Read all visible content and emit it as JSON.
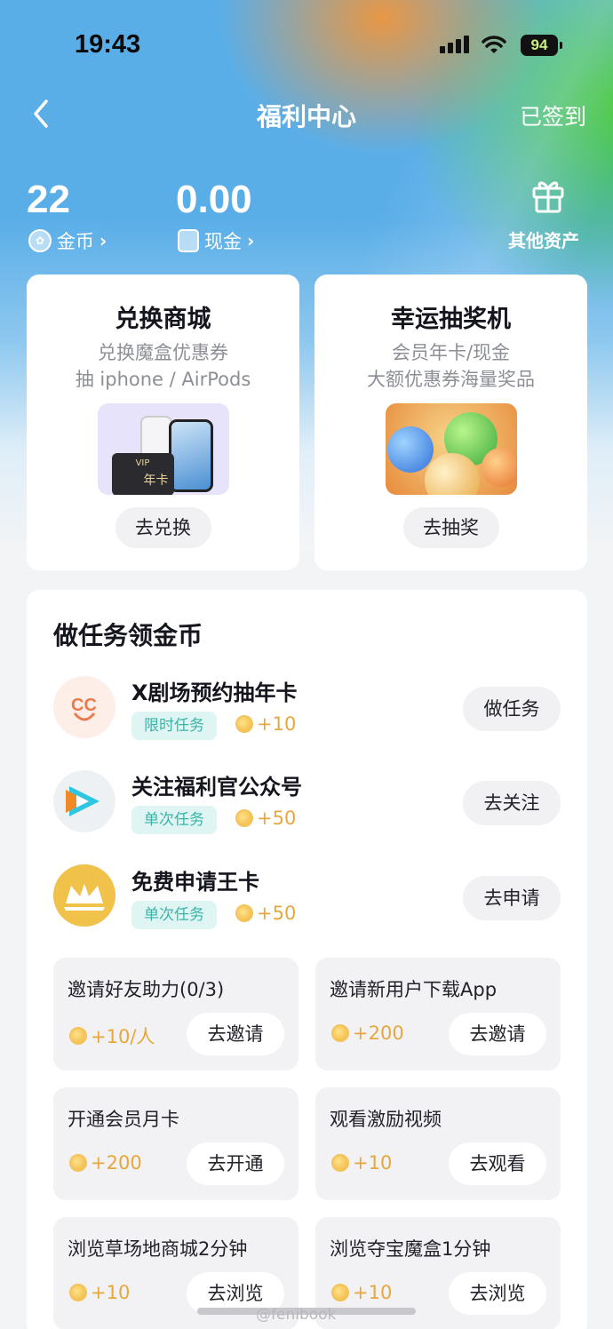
{
  "status_bar": {
    "time": "19:43",
    "battery": "94"
  },
  "nav": {
    "title": "福利中心",
    "signed_in": "已签到"
  },
  "balance": {
    "coins_value": "22",
    "coins_label": "金币",
    "cash_value": "0.00",
    "cash_label": "现金",
    "other_assets_label": "其他资产"
  },
  "promos": [
    {
      "title": "兑换商城",
      "line1": "兑换魔盒优惠券",
      "line2": "抽 iphone / AirPods",
      "image_text": "VIP",
      "image_text2": "年卡",
      "button": "去兑换"
    },
    {
      "title": "幸运抽奖机",
      "line1": "会员年卡/现金",
      "line2": "大额优惠券海量奖品",
      "button": "去抽奖"
    }
  ],
  "tasks": {
    "title": "做任务领金币",
    "items": [
      {
        "name": "X剧场预约抽年卡",
        "tag": "限时任务",
        "reward": "+10",
        "button": "做任务",
        "icon": "cc-logo-icon"
      },
      {
        "name": "关注福利官公众号",
        "tag": "单次任务",
        "reward": "+50",
        "button": "去关注",
        "icon": "play-logo-icon"
      },
      {
        "name": "免费申请王卡",
        "tag": "单次任务",
        "reward": "+50",
        "button": "去申请",
        "icon": "crown-logo-icon"
      }
    ],
    "grid": [
      {
        "title": "邀请好友助力(0/3)",
        "reward": "+10/人",
        "button": "去邀请"
      },
      {
        "title": "邀请新用户下载App",
        "reward": "+200",
        "button": "去邀请"
      },
      {
        "title": "开通会员月卡",
        "reward": "+200",
        "button": "去开通"
      },
      {
        "title": "观看激励视频",
        "reward": "+10",
        "button": "去观看"
      },
      {
        "title": "浏览草场地商城2分钟",
        "reward": "+10",
        "button": "去浏览"
      },
      {
        "title": "浏览夺宝魔盒1分钟",
        "reward": "+10",
        "button": "去浏览"
      }
    ]
  },
  "watermark": "@fenibook"
}
